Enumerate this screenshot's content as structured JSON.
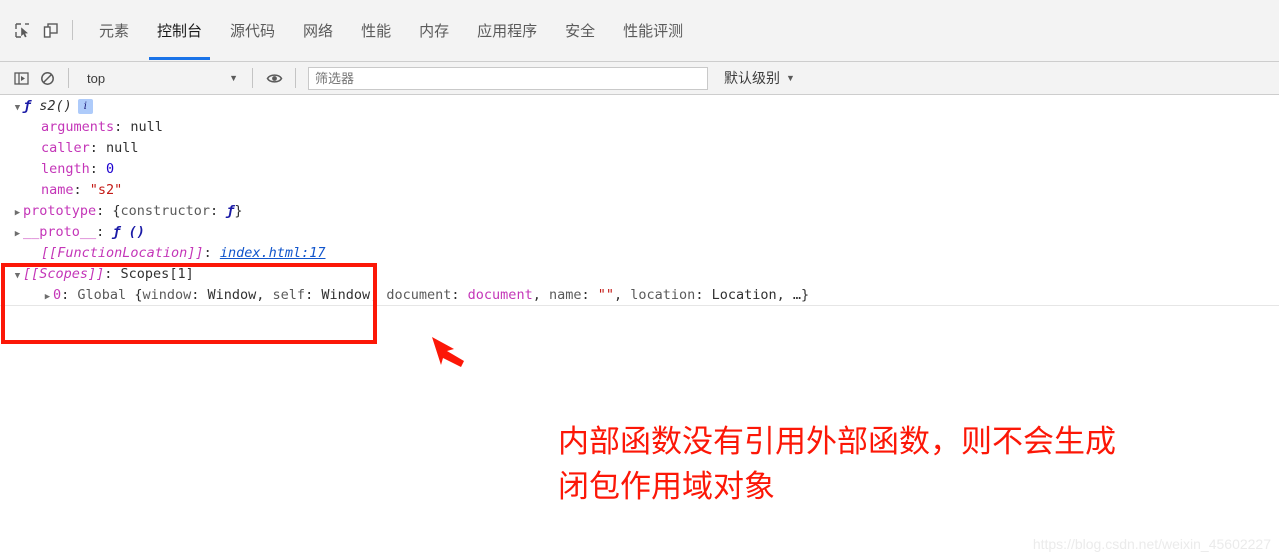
{
  "devtools": {
    "toolbar_icons": [
      {
        "name": "inspect-element-icon",
        "title": "inspect"
      },
      {
        "name": "device-toolbar-icon",
        "title": "device toolbar"
      }
    ],
    "tabs": [
      {
        "label": "元素",
        "active": false
      },
      {
        "label": "控制台",
        "active": true
      },
      {
        "label": "源代码",
        "active": false
      },
      {
        "label": "网络",
        "active": false
      },
      {
        "label": "性能",
        "active": false
      },
      {
        "label": "内存",
        "active": false
      },
      {
        "label": "应用程序",
        "active": false
      },
      {
        "label": "安全",
        "active": false
      },
      {
        "label": "性能评测",
        "active": false
      }
    ]
  },
  "console_toolbar": {
    "sidebar_toggle_icon": "console-sidebar-icon",
    "clear_icon": "clear-console-icon",
    "context": "top",
    "eye_icon": "live-expression-eye-icon",
    "filter_placeholder": "筛选器",
    "filter_value": "",
    "level": "默认级别"
  },
  "console": {
    "rows": [
      {
        "id": "fn-header",
        "indent": 1,
        "toggle": "down",
        "segments": [
          {
            "text": "ƒ",
            "cls": "kw-f"
          },
          {
            "text": " ",
            "cls": "plain"
          },
          {
            "text": "s2()",
            "cls": "fname"
          }
        ],
        "badge": "i"
      },
      {
        "id": "arguments",
        "indent": 2,
        "toggle": "none",
        "segments": [
          {
            "text": "arguments",
            "cls": "prop"
          },
          {
            "text": ": ",
            "cls": "plain"
          },
          {
            "text": "null",
            "cls": "nullv"
          }
        ]
      },
      {
        "id": "caller",
        "indent": 2,
        "toggle": "none",
        "segments": [
          {
            "text": "caller",
            "cls": "prop"
          },
          {
            "text": ": ",
            "cls": "plain"
          },
          {
            "text": "null",
            "cls": "nullv"
          }
        ]
      },
      {
        "id": "length",
        "indent": 2,
        "toggle": "none",
        "segments": [
          {
            "text": "length",
            "cls": "prop"
          },
          {
            "text": ": ",
            "cls": "plain"
          },
          {
            "text": "0",
            "cls": "num"
          }
        ]
      },
      {
        "id": "name",
        "indent": 2,
        "toggle": "none",
        "segments": [
          {
            "text": "name",
            "cls": "prop"
          },
          {
            "text": ": ",
            "cls": "plain"
          },
          {
            "text": "\"s2\"",
            "cls": "str"
          }
        ]
      },
      {
        "id": "prototype",
        "indent": 1,
        "toggle": "right",
        "segments": [
          {
            "text": "prototype",
            "cls": "prop"
          },
          {
            "text": ": {",
            "cls": "plain"
          },
          {
            "text": "constructor",
            "cls": "dim"
          },
          {
            "text": ": ",
            "cls": "plain"
          },
          {
            "text": "ƒ",
            "cls": "kw-f"
          },
          {
            "text": "}",
            "cls": "plain"
          }
        ]
      },
      {
        "id": "proto",
        "indent": 1,
        "toggle": "right",
        "segments": [
          {
            "text": "__proto__",
            "cls": "prop"
          },
          {
            "text": ": ",
            "cls": "plain"
          },
          {
            "text": "ƒ ()",
            "cls": "kw-f"
          }
        ]
      },
      {
        "id": "function-location",
        "indent": 2,
        "toggle": "none",
        "segments": [
          {
            "text": "[[FunctionLocation]]",
            "cls": "internal"
          },
          {
            "text": ": ",
            "cls": "plain"
          },
          {
            "text": "index.html:17",
            "cls": "link"
          }
        ]
      },
      {
        "id": "scopes",
        "indent": 1,
        "toggle": "down",
        "segments": [
          {
            "text": "[[Scopes]]",
            "cls": "internal"
          },
          {
            "text": ": ",
            "cls": "plain"
          },
          {
            "text": "Scopes[1]",
            "cls": "plain"
          }
        ]
      },
      {
        "id": "scope-0-global",
        "indent": 3,
        "toggle": "right",
        "sep_below": true,
        "segments": [
          {
            "text": "0",
            "cls": "pink"
          },
          {
            "text": ": ",
            "cls": "plain"
          },
          {
            "text": "Global",
            "cls": "dim"
          },
          {
            "text": " {",
            "cls": "plain"
          },
          {
            "text": "window",
            "cls": "dim"
          },
          {
            "text": ": ",
            "cls": "plain"
          },
          {
            "text": "Window",
            "cls": "plain"
          },
          {
            "text": ", ",
            "cls": "plain"
          },
          {
            "text": "self",
            "cls": "dim"
          },
          {
            "text": ": ",
            "cls": "plain"
          },
          {
            "text": "Window",
            "cls": "plain"
          },
          {
            "text": ", ",
            "cls": "plain"
          },
          {
            "text": "document",
            "cls": "dim"
          },
          {
            "text": ": ",
            "cls": "plain"
          },
          {
            "text": "document",
            "cls": "pink"
          },
          {
            "text": ", ",
            "cls": "plain"
          },
          {
            "text": "name",
            "cls": "dim"
          },
          {
            "text": ": ",
            "cls": "plain"
          },
          {
            "text": "\"\"",
            "cls": "str"
          },
          {
            "text": ", ",
            "cls": "plain"
          },
          {
            "text": "location",
            "cls": "dim"
          },
          {
            "text": ": ",
            "cls": "plain"
          },
          {
            "text": "Location",
            "cls": "plain"
          },
          {
            "text": ", …}",
            "cls": "plain"
          }
        ]
      }
    ],
    "prompt_caret": "›",
    "prompt_value": ""
  },
  "annotation": {
    "line1": "内部函数没有引用外部函数，则不会生成",
    "line2": "闭包作用域对象",
    "color": "#fc1707"
  },
  "highlight_box": {
    "color": "#fc1707"
  },
  "watermark": {
    "text": "https://blog.csdn.net/weixin_45602227"
  }
}
